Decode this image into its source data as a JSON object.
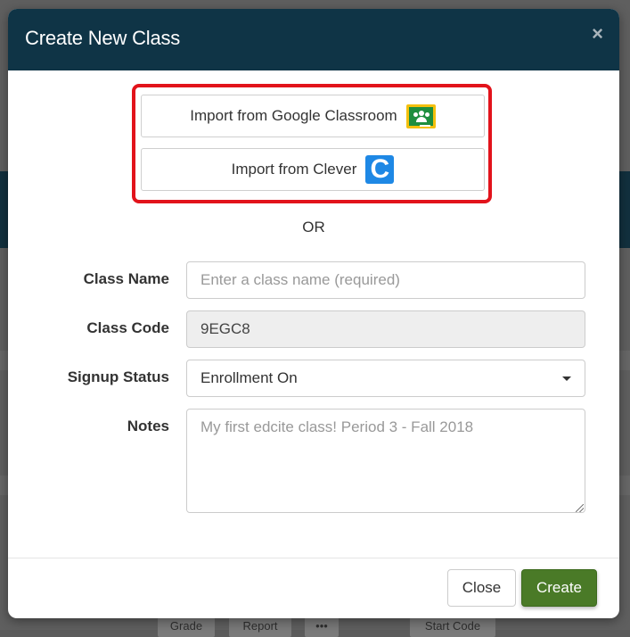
{
  "modal": {
    "title": "Create New Class",
    "close_icon": "×"
  },
  "imports": {
    "google_label": "Import from Google Classroom",
    "clever_label": "Import from Clever",
    "clever_glyph": "C"
  },
  "or_text": "OR",
  "form": {
    "class_name_label": "Class Name",
    "class_name_placeholder": "Enter a class name (required)",
    "class_name_value": "",
    "class_code_label": "Class Code",
    "class_code_value": "9EGC8",
    "signup_status_label": "Signup Status",
    "signup_status_value": "Enrollment On",
    "notes_label": "Notes",
    "notes_placeholder": "My first edcite class! Period 3 - Fall 2018"
  },
  "footer": {
    "close_label": "Close",
    "create_label": "Create"
  },
  "background": {
    "buttons": [
      "Grade",
      "Report",
      "•••",
      "Start Code"
    ]
  },
  "colors": {
    "header_bg": "#0f3446",
    "highlight_border": "#e2131b",
    "create_button": "#4a7a27",
    "google_classroom_yellow": "#f4c00d",
    "google_classroom_green": "#1e8e3e",
    "clever_blue": "#1e88e5"
  }
}
